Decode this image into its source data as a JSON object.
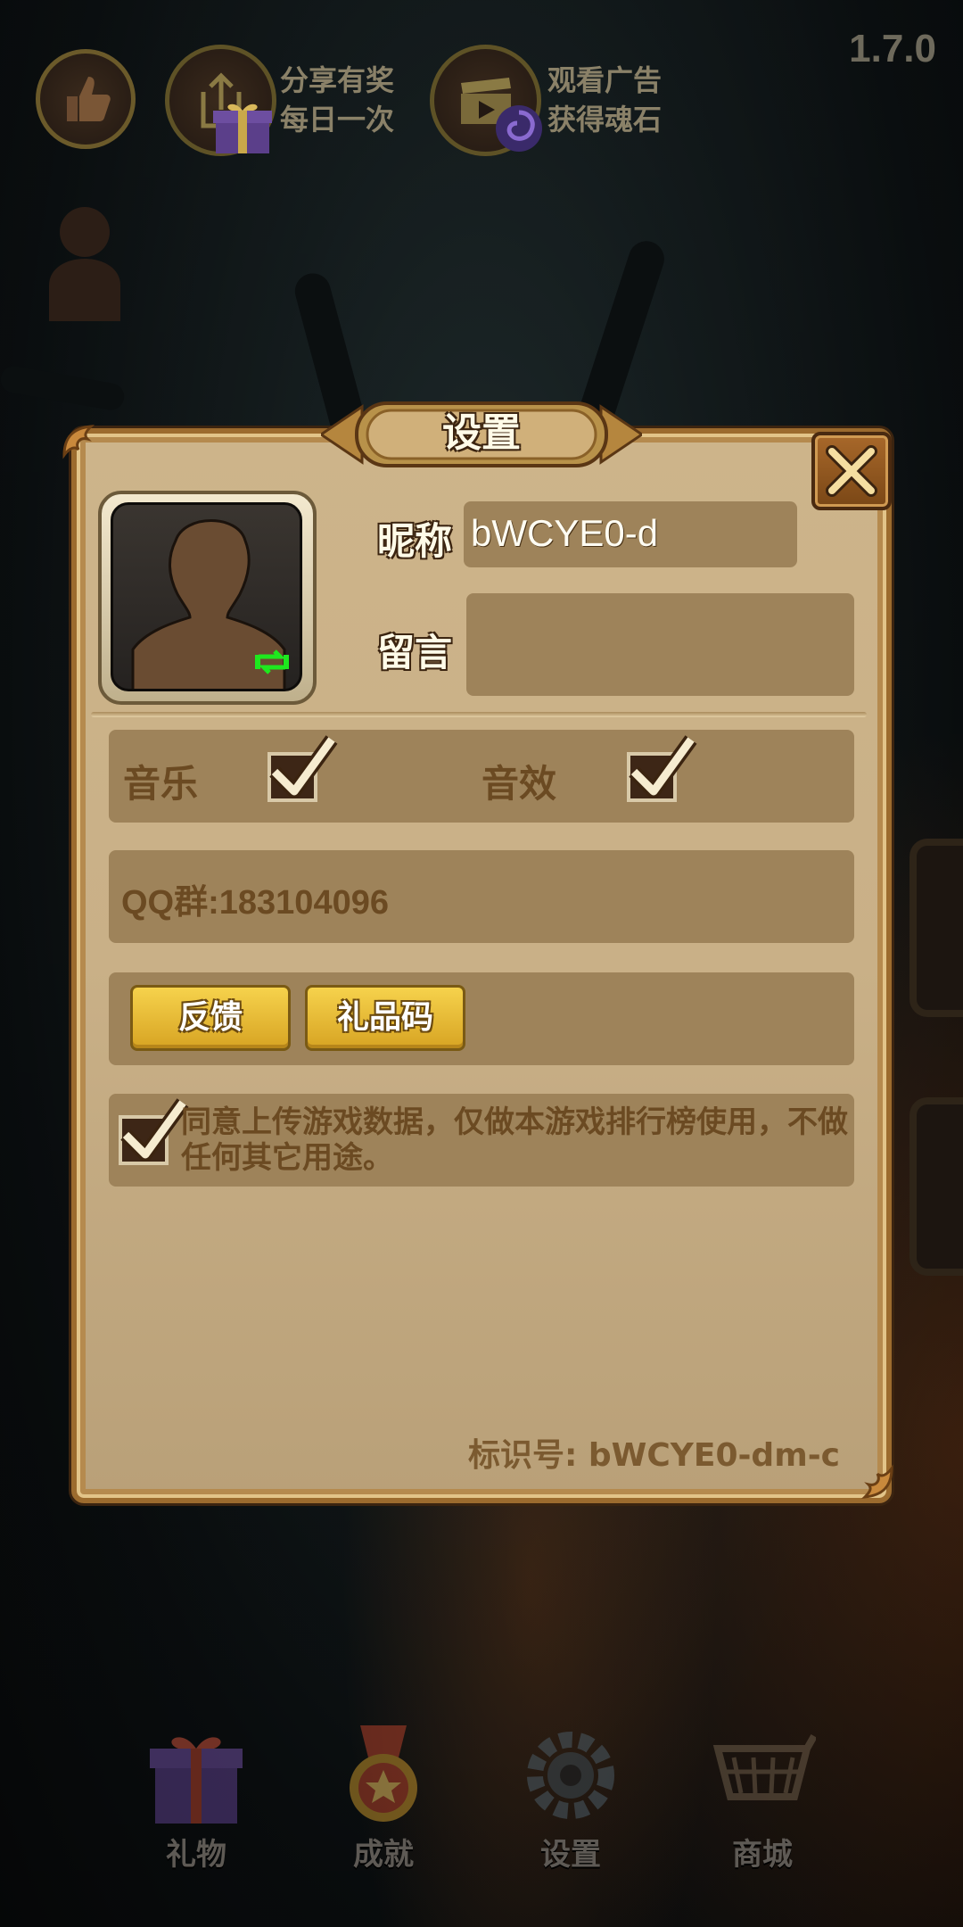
{
  "hud": {
    "like_icon": "thumbs-up-icon",
    "share_line1": "分享有奖",
    "share_line2": "每日一次",
    "ad_line1": "观看广告",
    "ad_line2": "获得魂石",
    "version": "1.7.0"
  },
  "settings": {
    "title": "设置",
    "nickname_label": "昵称",
    "nickname_value": "bWCYE0-d",
    "message_label": "留言",
    "message_value": "",
    "music_label": "音乐",
    "music_checked": true,
    "sfx_label": "音效",
    "sfx_checked": true,
    "qq_group": "QQ群:183104096",
    "feedback_label": "反馈",
    "gift_code_label": "礼品码",
    "agree_checked": true,
    "agree_text": "同意上传游戏数据，仅做本游戏排行榜使用，不做任何其它用途。",
    "id_label": "标识号: bWCYE0-dm-c"
  },
  "bottom_nav": [
    {
      "label": "礼物",
      "icon": "gift-icon"
    },
    {
      "label": "成就",
      "icon": "medal-icon"
    },
    {
      "label": "设置",
      "icon": "gear-icon"
    },
    {
      "label": "商城",
      "icon": "cart-icon"
    }
  ],
  "colors": {
    "panel": "#c9b087",
    "panel_border": "#9c6b2e",
    "field": "#9e835a",
    "button_gold": "#f0c63c",
    "checkbox": "#3d2616"
  }
}
